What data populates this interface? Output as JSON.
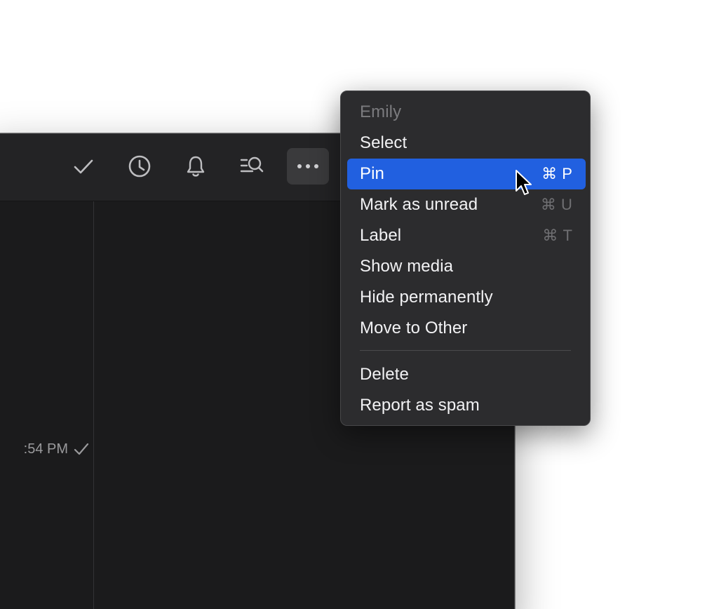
{
  "toolbar": {
    "buttons": [
      {
        "icon": "checkmark-icon"
      },
      {
        "icon": "clock-icon"
      },
      {
        "icon": "bell-icon"
      },
      {
        "icon": "search-list-icon"
      },
      {
        "icon": "more-icon",
        "active": true
      }
    ]
  },
  "conversation_row": {
    "time_text": ":54 PM",
    "status_icon": "checkmark-icon"
  },
  "context_menu": {
    "header": "Emily",
    "items": [
      {
        "label": "Select",
        "shortcut_symbol": "",
        "shortcut_key": ""
      },
      {
        "label": "Pin",
        "shortcut_symbol": "⌘",
        "shortcut_key": "P",
        "highlighted": true
      },
      {
        "label": "Mark as unread",
        "shortcut_symbol": "⌘",
        "shortcut_key": "U"
      },
      {
        "label": "Label",
        "shortcut_symbol": "⌘",
        "shortcut_key": "T"
      },
      {
        "label": "Show media",
        "shortcut_symbol": "",
        "shortcut_key": ""
      },
      {
        "label": "Hide permanently",
        "shortcut_symbol": "",
        "shortcut_key": ""
      },
      {
        "label": "Move to Other",
        "shortcut_symbol": "",
        "shortcut_key": ""
      },
      {
        "label": "Delete",
        "shortcut_symbol": "",
        "shortcut_key": ""
      },
      {
        "label": "Report as spam",
        "shortcut_symbol": "",
        "shortcut_key": ""
      }
    ]
  },
  "colors": {
    "menu_background": "#2c2c2e",
    "highlight": "#2160e0",
    "window_background": "#1b1b1c",
    "toolbar_background": "#232325"
  }
}
